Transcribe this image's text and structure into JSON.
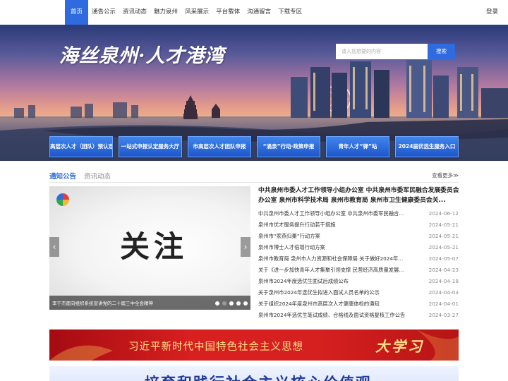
{
  "nav": {
    "items": [
      {
        "label": "首页",
        "active": true
      },
      {
        "label": "通告公示"
      },
      {
        "label": "资讯动态"
      },
      {
        "label": "魅力泉州"
      },
      {
        "label": "风采展示"
      },
      {
        "label": "平台载体"
      },
      {
        "label": "沟通留言"
      },
      {
        "label": "下载专区"
      }
    ],
    "login": "登录"
  },
  "banner": {
    "slogan": "海丝泉州·人才港湾",
    "search_placeholder": "请入您想要的内容",
    "search_button": "搜索"
  },
  "quick_links": [
    "高层次人才（团队）预认定",
    "一站式申报认定服务大厅",
    "市高层次人才团队申报",
    "“涌泉”行动·政策申报",
    "青年人才“驿”站",
    "2024届优选生服务入口"
  ],
  "notices": {
    "tabs": [
      "通知公告",
      "资讯动态"
    ],
    "more": "查看更多≫",
    "carousel": {
      "title": "关注",
      "caption": "李于杰面向组织系统宣讲党的二十届三中全会精神",
      "dot_count": 5,
      "active_dot": 1
    },
    "headline": "中共泉州市委人才工作领导小组办公室 中共泉州市委军民融合发展委员会办公室 泉州市科学技术局 泉州市教育局 泉州市卫生健康委员会关...",
    "items": [
      {
        "title": "中共泉州市委人才工作领导小组办公室 中共泉州市委军民融合...",
        "date": "2024-06-12"
      },
      {
        "title": "泉州市优才服务提升行动若干措施",
        "date": "2024-05-21"
      },
      {
        "title": "泉州市“家燕归巢”行动方案",
        "date": "2024-05-21"
      },
      {
        "title": "泉州市博士人才倍增行动方案",
        "date": "2024-05-21"
      },
      {
        "title": "泉州市教育局 泉州市人力资源和社会保障局 关于做好2024年...",
        "date": "2024-05-07"
      },
      {
        "title": "关于《进一步加快青年人才集聚引领支撑 民营经济高质量发展...",
        "date": "2024-04-23"
      },
      {
        "title": "泉州市2024年度选优生面试后成绩公布",
        "date": "2024-04-18"
      },
      {
        "title": "关于泉州市2024年选优生拟进入面试人员名单的公示",
        "date": "2024-04-03"
      },
      {
        "title": "关于组织2024年度泉州市高层次人才健康体检的通知",
        "date": "2024-04-01"
      },
      {
        "title": "泉州市2024年选优生笔试成绩、合格线及面试资格复核工作公告",
        "date": "2024-03-27"
      }
    ]
  },
  "promos": {
    "banner1_text": "习近平新时代中国特色社会主义思想",
    "banner1_brush": "大学习",
    "banner2_text": "培育和践行社会主义核心价值观"
  },
  "colors": {
    "primary": "#2f6bde",
    "promo_red": "#d8201f",
    "promo_gold": "#ffe38a"
  }
}
